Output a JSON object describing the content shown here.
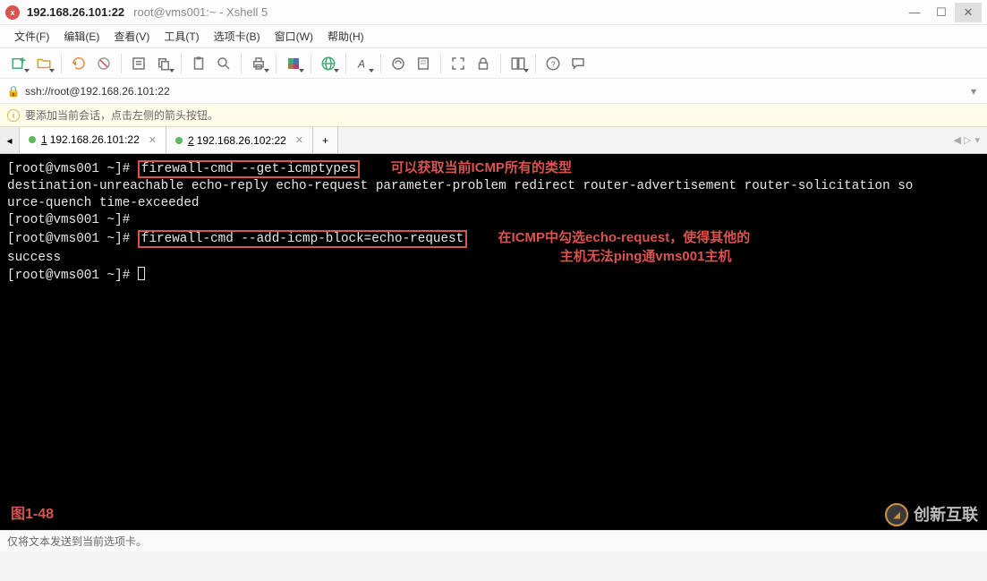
{
  "titlebar": {
    "ip": "192.168.26.101:22",
    "path": "root@vms001:~ - Xshell 5"
  },
  "menubar": {
    "items": [
      "文件(F)",
      "编辑(E)",
      "查看(V)",
      "工具(T)",
      "选项卡(B)",
      "窗口(W)",
      "帮助(H)"
    ]
  },
  "addressbar": {
    "url": "ssh://root@192.168.26.101:22"
  },
  "infobar": {
    "text": "要添加当前会话，点击左侧的箭头按钮。"
  },
  "tabs": {
    "items": [
      {
        "num": "1",
        "label": "192.168.26.101:22",
        "active": true
      },
      {
        "num": "2",
        "label": "192.168.26.102:22",
        "active": false
      }
    ],
    "add": "+"
  },
  "terminal": {
    "prompt": "[root@vms001 ~]#",
    "cmd1": "firewall-cmd --get-icmptypes",
    "ann1": "可以获取当前ICMP所有的类型",
    "out1a": "destination-unreachable echo-reply echo-request parameter-problem redirect router-advertisement router-solicitation so",
    "out1b": "urce-quench time-exceeded",
    "cmd2": "firewall-cmd --add-icmp-block=echo-request",
    "ann2a": "在ICMP中勾选echo-request，使得其他的",
    "ann2b": "主机无法ping通vms001主机",
    "out2": "success",
    "figlabel": "图1-48",
    "watermark": "创新互联"
  },
  "statusbar": {
    "text": "仅将文本发送到当前选项卡。"
  }
}
